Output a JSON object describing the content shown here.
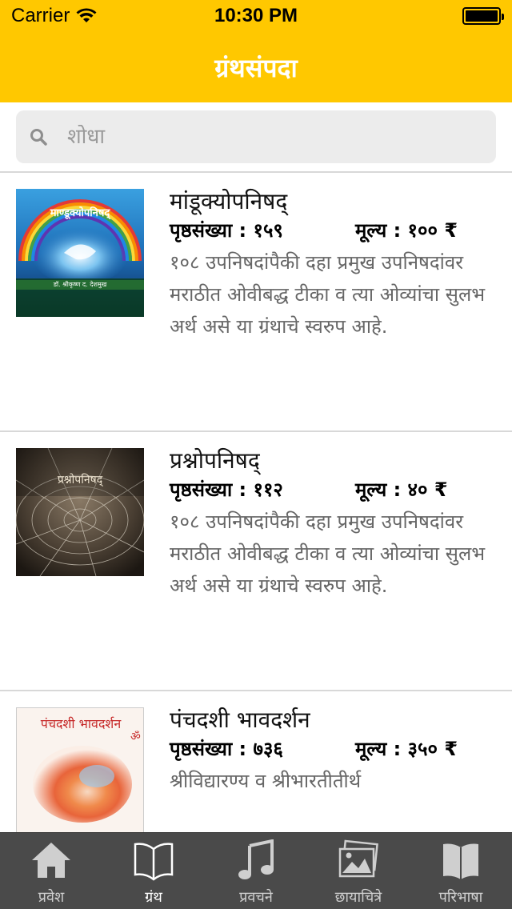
{
  "status_bar": {
    "carrier": "Carrier",
    "time": "10:30 PM",
    "battery_level": 1.0
  },
  "nav": {
    "title": "ग्रंथसंपदा"
  },
  "search": {
    "placeholder": "शोधा",
    "value": ""
  },
  "books": [
    {
      "title": "मांडूक्योपनिषद्",
      "pages": "पृष्ठसंख्या : १५९",
      "price": "मूल्य : १०० ₹",
      "description": "१०८ उपनिषदांपैकी दहा प्रमुख उपनिषदांवर मराठीत ओवीबद्ध टीका व त्या ओव्यांचा सुलभ अर्थ असे या ग्रंथाचे स्वरुप आहे.",
      "cover_text": "माण्डूक्योपनिषद्",
      "cover_author": "डॉ. श्रीकृष्ण द. देशमुख"
    },
    {
      "title": "प्रश्नोपनिषद्",
      "pages": "पृष्ठसंख्या : ११२",
      "price": "मूल्य : ४० ₹",
      "description": "१०८ उपनिषदांपैकी दहा प्रमुख उपनिषदांवर मराठीत ओवीबद्ध टीका व त्या ओव्यांचा सुलभ अर्थ असे या ग्रंथाचे स्वरुप आहे.",
      "cover_text": "प्रश्नोपनिषद्"
    },
    {
      "title": "पंचदशी भावदर्शन",
      "pages": "पृष्ठसंख्या : ७३६",
      "price": "मूल्य : ३५० ₹",
      "description": "श्रीविद्यारण्य व श्रीभारतीतीर्थ",
      "cover_text": "पंचदशी भावदर्शन"
    }
  ],
  "tabs": [
    {
      "label": "प्रवेश",
      "icon": "home-icon",
      "active": false
    },
    {
      "label": "ग्रंथ",
      "icon": "book-open-icon",
      "active": true
    },
    {
      "label": "प्रवचने",
      "icon": "music-note-icon",
      "active": false
    },
    {
      "label": "छायाचित्रे",
      "icon": "photos-icon",
      "active": false
    },
    {
      "label": "परिभाषा",
      "icon": "dictionary-icon",
      "active": false
    }
  ],
  "colors": {
    "accent": "#ffc800",
    "tab_bar": "#4a4a4a",
    "description": "#666666"
  }
}
